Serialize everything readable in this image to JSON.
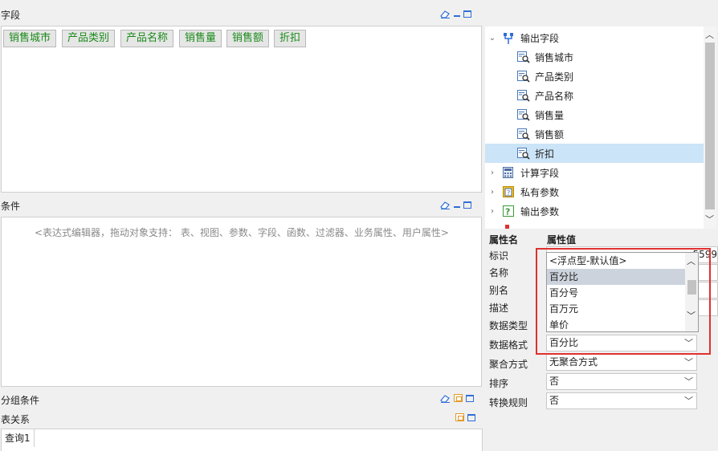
{
  "sections": {
    "fields_title": "字段",
    "conditions_title": "条件",
    "group_title": "分组条件",
    "relation_title": "表关系"
  },
  "field_chips": [
    "销售城市",
    "产品类别",
    "产品名称",
    "销售量",
    "销售额",
    "折扣"
  ],
  "conditions_placeholder": "<表达式编辑器，拖动对象支持： 表、视图、参数、字段、函数、过滤器、业务属性、用户属性>",
  "relation_tab": "查询1",
  "tree": {
    "root": "输出字段",
    "children": [
      "销售城市",
      "产品类别",
      "产品名称",
      "销售量",
      "销售额",
      "折扣"
    ],
    "selected": "折扣",
    "groups": [
      "计算字段",
      "私有参数",
      "输出参数",
      "..."
    ]
  },
  "properties": {
    "header_name": "属性名",
    "header_value": "属性值",
    "rows": [
      {
        "name": "标识",
        "value": "...5599"
      },
      {
        "name": "名称",
        "value": ""
      },
      {
        "name": "别名",
        "value": ""
      },
      {
        "name": "描述",
        "value": ""
      },
      {
        "name": "数据类型",
        "value": ""
      },
      {
        "name": "数据格式",
        "value": "百分比"
      },
      {
        "name": "聚合方式",
        "value": "无聚合方式"
      },
      {
        "name": "排序",
        "value": "否"
      },
      {
        "name": "转换规则",
        "value": "否"
      }
    ]
  },
  "format_dropdown": {
    "options": [
      "<浮点型-默认值>",
      "百分比",
      "百分号",
      "百万元",
      "单价"
    ],
    "highlighted": "百分比"
  },
  "colors": {
    "chip_text": "#1a8a1a",
    "highlight_box": "#e03030",
    "selection": "#cce4f7",
    "icon_blue": "#2f6fd6",
    "icon_orange": "#e09a2b"
  }
}
